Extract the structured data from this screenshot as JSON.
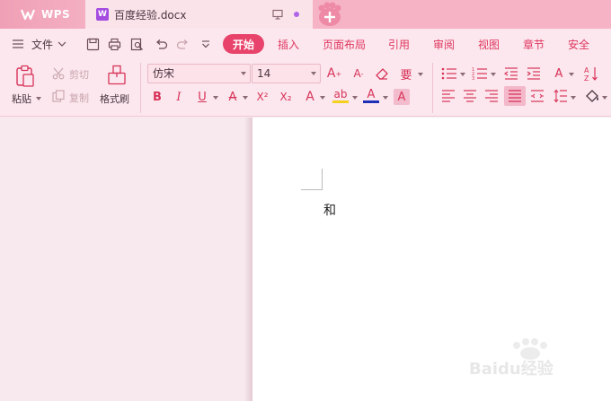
{
  "titlebar": {
    "app_name": "WPS",
    "document_tab": "百度经验.docx"
  },
  "menu": {
    "file_label": "文件",
    "tabs": [
      "开始",
      "插入",
      "页面布局",
      "引用",
      "审阅",
      "视图",
      "章节",
      "安全"
    ],
    "active_tab": "开始"
  },
  "ribbon": {
    "paste_label": "粘贴",
    "cut_label": "剪切",
    "copy_label": "复制",
    "format_painter_label": "格式刷",
    "font_name": "仿宋",
    "font_size": "14",
    "bold": "B",
    "italic": "I",
    "underline": "U",
    "strike": "A",
    "superscript": "X²",
    "subscript": "X₂",
    "highlight": "ab",
    "font_color": "A",
    "char_shading": "A",
    "phonetic": "要",
    "grow_font": "A",
    "shrink_font": "A"
  },
  "document": {
    "content": "和"
  },
  "watermark": {
    "text": "Baidu经验"
  },
  "colors": {
    "accent": "#e8446b",
    "titlebar": "#f5b3c5",
    "toolbar_bg": "#fbe7ed",
    "page_bg": "#ffffff"
  }
}
